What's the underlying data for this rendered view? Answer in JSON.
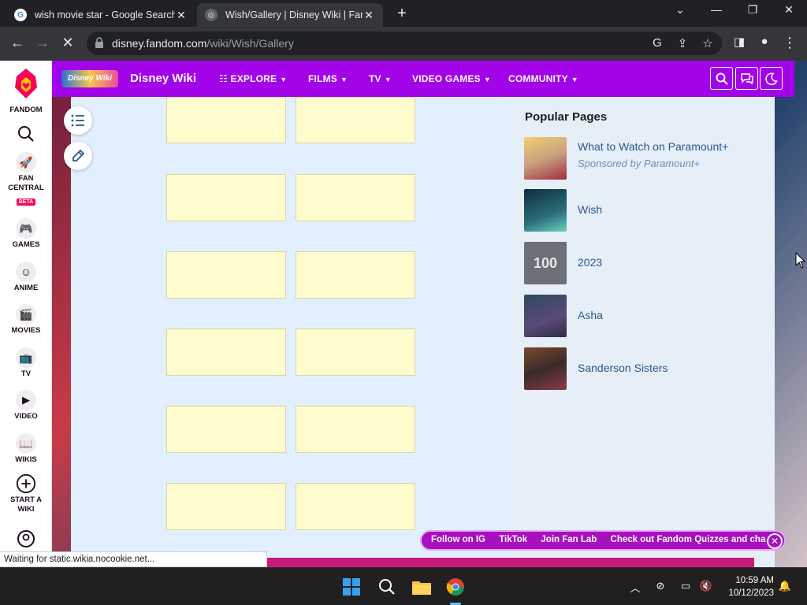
{
  "browser": {
    "tabs": [
      {
        "title": "wish movie star - Google Search",
        "favicon": "google-icon",
        "active": false
      },
      {
        "title": "Wish/Gallery | Disney Wiki | Fandom",
        "favicon": "fandom-icon",
        "active": true
      }
    ],
    "url_host": "disney.fandom.com",
    "url_path": "/wiki/Wish/Gallery"
  },
  "fandom_rail": {
    "brand": "FANDOM",
    "items": [
      {
        "label": "FAN CENTRAL",
        "icon": "rocket-icon",
        "badge": "BETA"
      },
      {
        "label": "GAMES",
        "icon": "gamepad-icon"
      },
      {
        "label": "ANIME",
        "icon": "anime-icon"
      },
      {
        "label": "MOVIES",
        "icon": "clapper-icon"
      },
      {
        "label": "TV",
        "icon": "tv-icon"
      },
      {
        "label": "VIDEO",
        "icon": "play-icon"
      },
      {
        "label": "WIKIS",
        "icon": "book-icon"
      },
      {
        "label": "START A WIKI",
        "icon": "plus-circle-icon"
      }
    ]
  },
  "wiki_nav": {
    "logo_text": "Disney Wiki",
    "wiki_name": "Disney Wiki",
    "items": [
      "EXPLORE",
      "FILMS",
      "TV",
      "VIDEO GAMES",
      "COMMUNITY"
    ]
  },
  "gallery": {
    "rows": 6,
    "columns": 2
  },
  "popular_pages": {
    "title": "Popular Pages",
    "items": [
      {
        "title": "What to Watch on Paramount+",
        "sponsor": "Sponsored by Paramount+",
        "thumb_color": "#c9b8a0"
      },
      {
        "title": "Wish",
        "thumb_color": "#1c4a5a"
      },
      {
        "title": "2023",
        "thumb_color": "#6e7078"
      },
      {
        "title": "Asha",
        "thumb_color": "#3e5a6e"
      },
      {
        "title": "Sanderson Sisters",
        "thumb_color": "#5a3a30"
      }
    ]
  },
  "promo_bar": {
    "items": [
      "Follow on IG",
      "TikTok",
      "Join Fan Lab",
      "Check out Fandom Quizzes and cha"
    ]
  },
  "status_text": "Waiting for static.wikia.nocookie.net...",
  "taskbar": {
    "time": "10:59 AM",
    "date": "10/12/2023"
  },
  "colors": {
    "fandom_pink": "#fa005a",
    "wiki_purple": "#a303e8",
    "thumb_fill": "#fefccd",
    "content_bg": "#e2efff"
  }
}
